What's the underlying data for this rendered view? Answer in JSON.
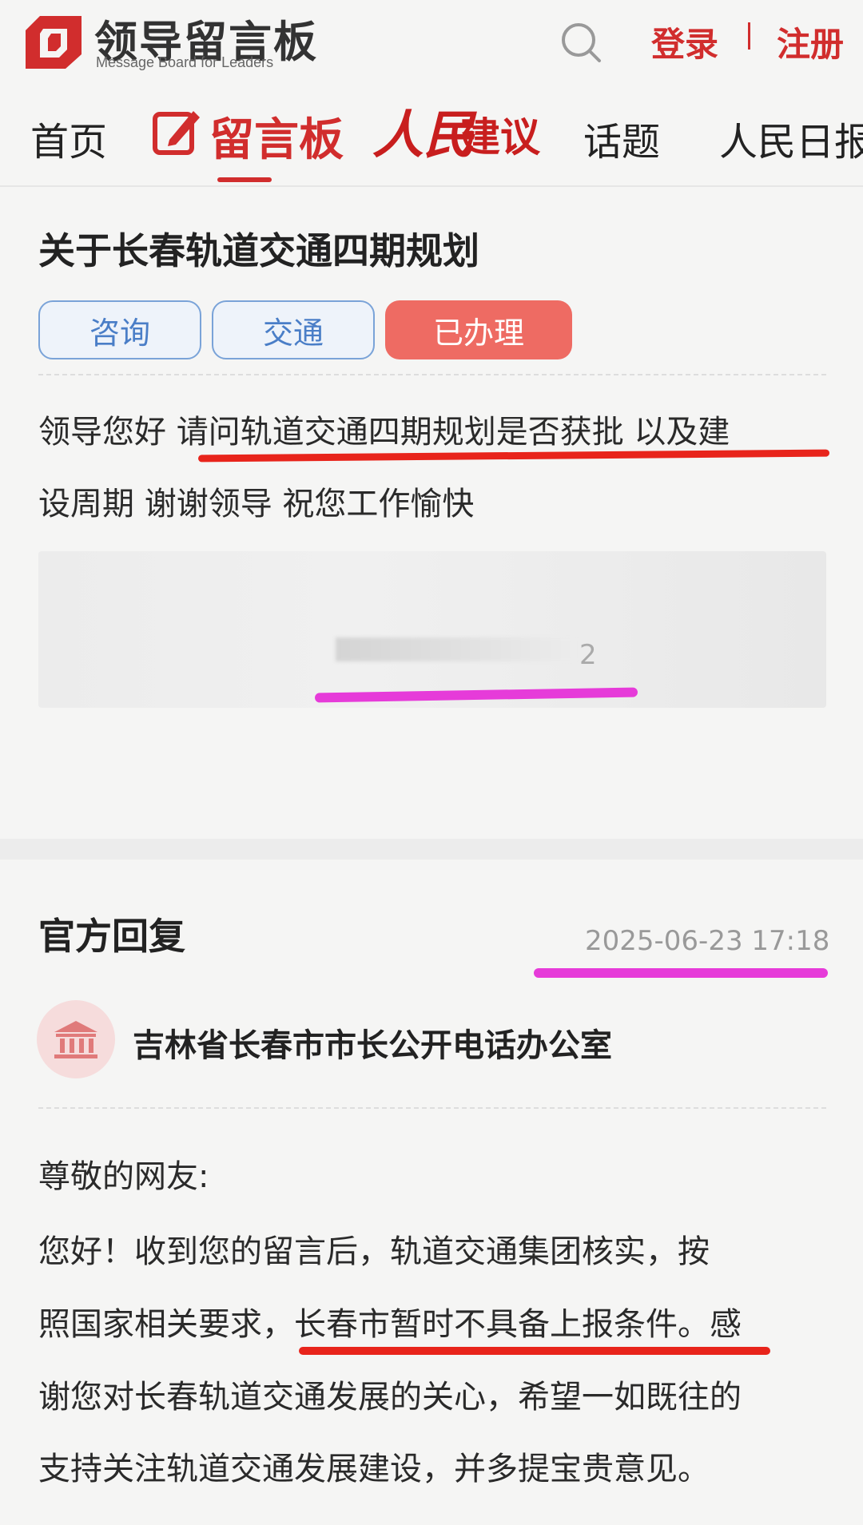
{
  "header": {
    "logo_cn": "领导留言板",
    "logo_en": "Message Board for Leaders",
    "login": "登录",
    "register": "注册"
  },
  "nav": {
    "home": "首页",
    "board": "留言板",
    "suggest_a": "人民",
    "suggest_b": "建议",
    "topic": "话题",
    "daily": "人民日报"
  },
  "message": {
    "title": "关于长春轨道交通四期规划",
    "tags": [
      "咨询",
      "交通",
      "已办理"
    ],
    "line1": "领导您好  请问轨道交通四期规划是否获批  以及建",
    "line2": "设周期 谢谢领导  祝您工作愉快",
    "blur_digit": "2"
  },
  "reply": {
    "title": "官方回复",
    "time": "2025-06-23 17:18",
    "office": "吉林省长春市市长公开电话办公室",
    "salutation": "尊敬的网友:",
    "line1": "    您好！收到您的留言后，轨道交通集团核实，按",
    "line2": "照国家相关要求，长春市暂时不具备上报条件。感",
    "line3": "谢您对长春轨道交通发展的关心，希望一如既往的",
    "line4": "支持关注轨道交通发展建设，并多提宝贵意见。"
  },
  "colors": {
    "brand_red": "#d12d2d",
    "tag_blue": "#4a7ec7",
    "tag_done": "#ee6b63",
    "annotation_red": "#e8241b",
    "annotation_pink": "#e63bd9"
  },
  "icons": [
    "logo-icon",
    "search-icon",
    "edit-icon",
    "government-building-icon"
  ]
}
